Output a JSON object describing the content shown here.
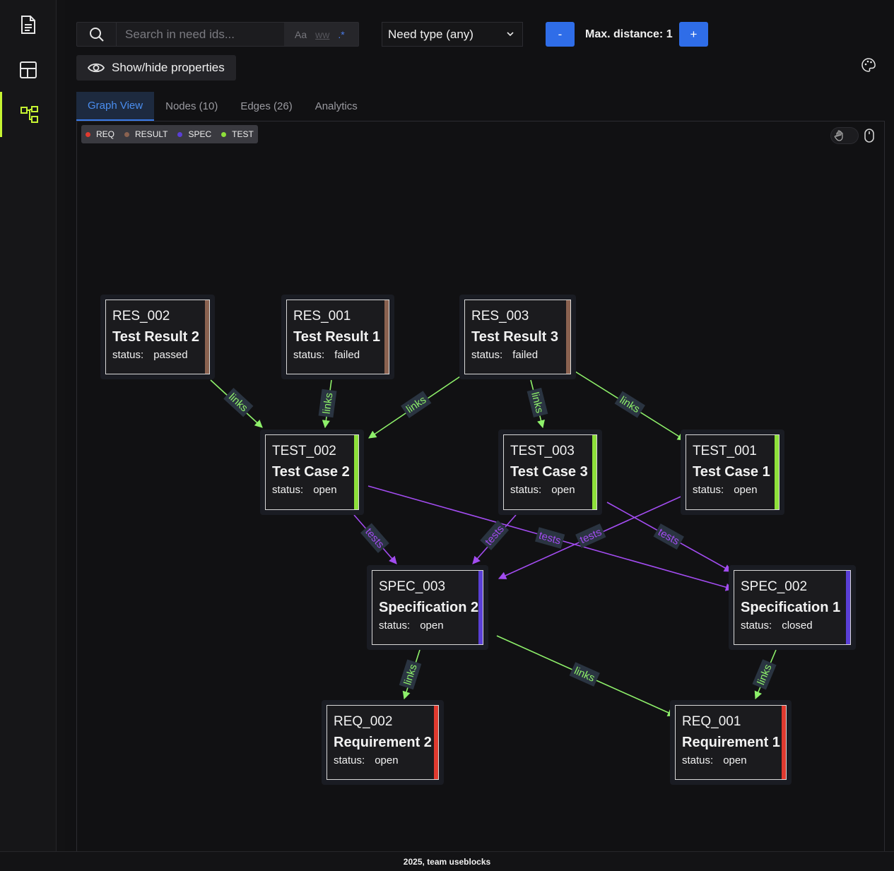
{
  "search": {
    "placeholder": "Search in need ids...",
    "opt_case": "Aa",
    "opt_word": "ww",
    "opt_regex": ".*"
  },
  "filters": {
    "type_select": "Need type (any)",
    "minus_label": "-",
    "plus_label": "+",
    "distance_label": "Max. distance:",
    "distance_value": "1"
  },
  "props_button": {
    "label": "Show/hide properties"
  },
  "tabs": [
    {
      "label": "Graph View",
      "active": true
    },
    {
      "label": "Nodes (10)",
      "active": false
    },
    {
      "label": "Edges (26)",
      "active": false
    },
    {
      "label": "Analytics",
      "active": false
    }
  ],
  "legend": [
    {
      "label": "REQ",
      "color": "#e03a2f"
    },
    {
      "label": "RESULT",
      "color": "#8a6250"
    },
    {
      "label": "SPEC",
      "color": "#5a3fd6"
    },
    {
      "label": "TEST",
      "color": "#8ee03a"
    }
  ],
  "colors": {
    "links_edge": "#8ef06a",
    "tests_edge": "#a24cf0",
    "accent": "#c6f432",
    "button": "#2f6de8"
  },
  "status_label": "status:",
  "nodes": [
    {
      "id": "RES_002",
      "title": "Test Result 2",
      "status": "passed",
      "type": "RESULT"
    },
    {
      "id": "RES_001",
      "title": "Test Result 1",
      "status": "failed",
      "type": "RESULT"
    },
    {
      "id": "RES_003",
      "title": "Test Result 3",
      "status": "failed",
      "type": "RESULT"
    },
    {
      "id": "TEST_002",
      "title": "Test Case 2",
      "status": "open",
      "type": "TEST"
    },
    {
      "id": "TEST_003",
      "title": "Test Case 3",
      "status": "open",
      "type": "TEST"
    },
    {
      "id": "TEST_001",
      "title": "Test Case 1",
      "status": "open",
      "type": "TEST"
    },
    {
      "id": "SPEC_003",
      "title": "Specification 2",
      "status": "open",
      "type": "SPEC"
    },
    {
      "id": "SPEC_002",
      "title": "Specification 1",
      "status": "closed",
      "type": "SPEC"
    },
    {
      "id": "REQ_002",
      "title": "Requirement 2",
      "status": "open",
      "type": "REQ"
    },
    {
      "id": "REQ_001",
      "title": "Requirement 1",
      "status": "open",
      "type": "REQ"
    }
  ],
  "edges": [
    {
      "from": "RES_002",
      "to": "TEST_002",
      "label": "links"
    },
    {
      "from": "RES_001",
      "to": "TEST_002",
      "label": "links"
    },
    {
      "from": "RES_003",
      "to": "TEST_002",
      "label": "links"
    },
    {
      "from": "RES_003",
      "to": "TEST_003",
      "label": "links"
    },
    {
      "from": "RES_003",
      "to": "TEST_001",
      "label": "links"
    },
    {
      "from": "TEST_002",
      "to": "SPEC_003",
      "label": "tests"
    },
    {
      "from": "TEST_002",
      "to": "SPEC_002",
      "label": "tests"
    },
    {
      "from": "TEST_003",
      "to": "SPEC_003",
      "label": "tests"
    },
    {
      "from": "TEST_003",
      "to": "SPEC_002",
      "label": "tests"
    },
    {
      "from": "TEST_001",
      "to": "SPEC_003",
      "label": "tests"
    },
    {
      "from": "SPEC_003",
      "to": "REQ_002",
      "label": "links"
    },
    {
      "from": "SPEC_003",
      "to": "REQ_001",
      "label": "links"
    },
    {
      "from": "SPEC_002",
      "to": "REQ_001",
      "label": "links"
    }
  ],
  "footer": {
    "text": "2025, team useblocks"
  }
}
